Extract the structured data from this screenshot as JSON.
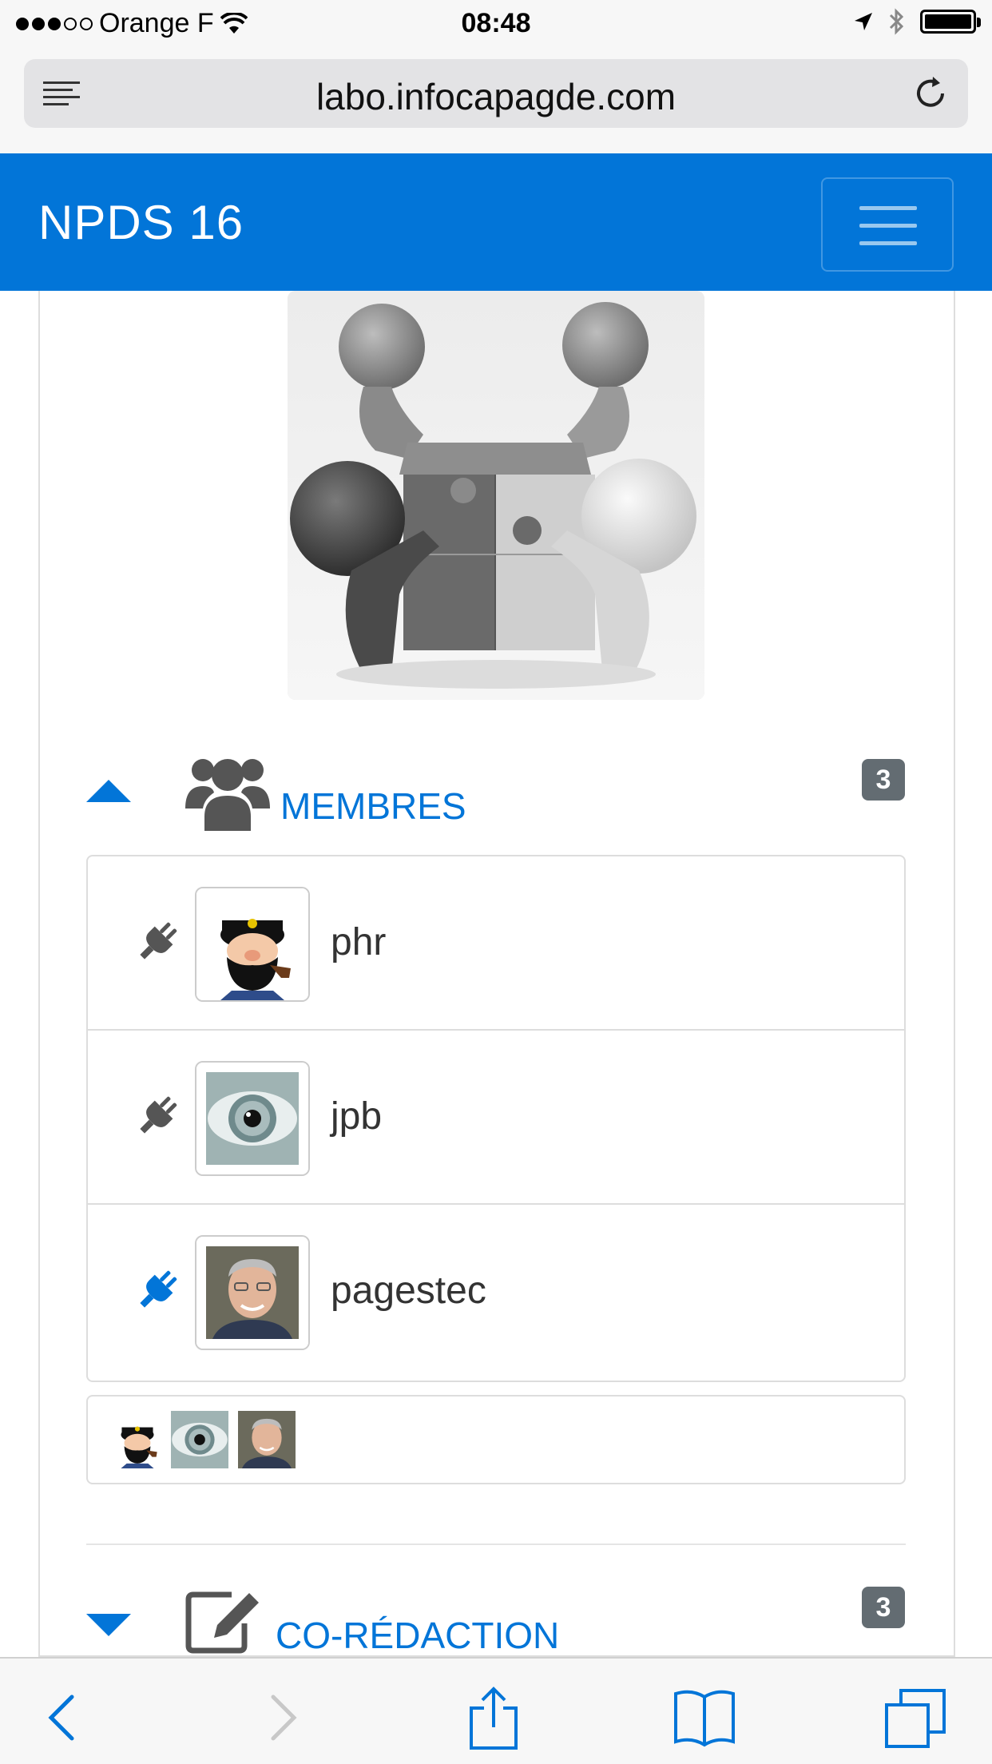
{
  "status_bar": {
    "carrier": "Orange F",
    "time": "08:48"
  },
  "browser": {
    "url": "labo.infocapagde.com"
  },
  "navbar": {
    "brand": "NPDS  16"
  },
  "members": {
    "title": "MEMBRES",
    "count": "3",
    "users": [
      {
        "name": "phr",
        "online": false
      },
      {
        "name": "jpb",
        "online": false
      },
      {
        "name": "pagestec",
        "online": true
      }
    ]
  },
  "coredaction": {
    "title": "CO-RÉDACTION",
    "count": "3"
  },
  "colors": {
    "primary": "#0275d8",
    "badge": "#636c72",
    "icon_gray": "#555555"
  }
}
